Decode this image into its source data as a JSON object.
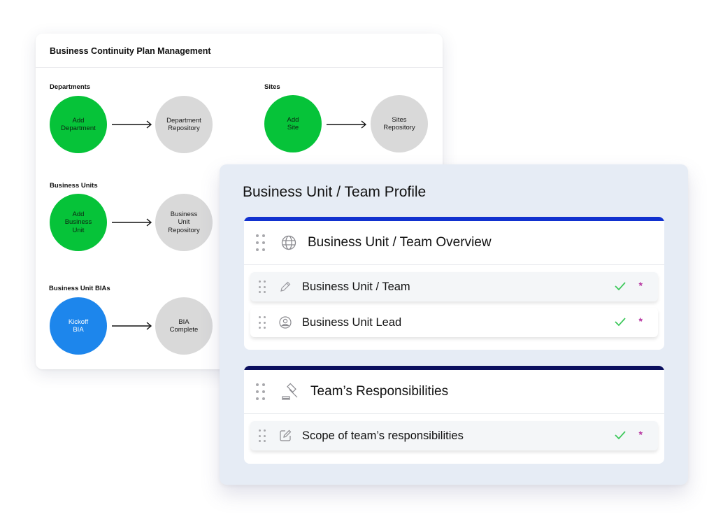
{
  "bcp": {
    "title": "Business Continuity Plan Management",
    "groups": [
      {
        "label": "Departments",
        "start": "Add\nDepartment",
        "end": "Department\nRepository",
        "start_color": "green"
      },
      {
        "label": "Sites",
        "start": "Add\nSite",
        "end": "Sites\nRepository",
        "start_color": "green"
      },
      {
        "label": "Business Units",
        "start": "Add\nBusiness\nUnit",
        "end": "Business\nUnit\nRepository",
        "start_color": "green"
      },
      {
        "label": "Business Unit BIAs",
        "start": "Kickoff\nBIA",
        "end": "BIA\nComplete",
        "start_color": "blue"
      }
    ]
  },
  "profile": {
    "title": "Business Unit / Team Profile",
    "sections": [
      {
        "title": "Business Unit / Team Overview",
        "icon": "globe-icon",
        "bar_color": "#1131cf",
        "items": [
          {
            "label": "Business Unit / Team",
            "icon": "pencil-icon",
            "complete": true,
            "required": "*"
          },
          {
            "label": "Business Unit Lead",
            "icon": "user-circle-icon",
            "complete": true,
            "required": "*"
          }
        ]
      },
      {
        "title": "Team’s Responsibilities",
        "icon": "gavel-icon",
        "bar_color": "#0b0f5e",
        "items": [
          {
            "label": "Scope of team’s responsibilities",
            "icon": "edit-square-icon",
            "complete": true,
            "required": "*"
          }
        ]
      }
    ]
  },
  "colors": {
    "green": "#06c339",
    "blue": "#1d86ec",
    "grey": "#d9d9d9",
    "check": "#3cc85a",
    "required": "#b6329f"
  }
}
